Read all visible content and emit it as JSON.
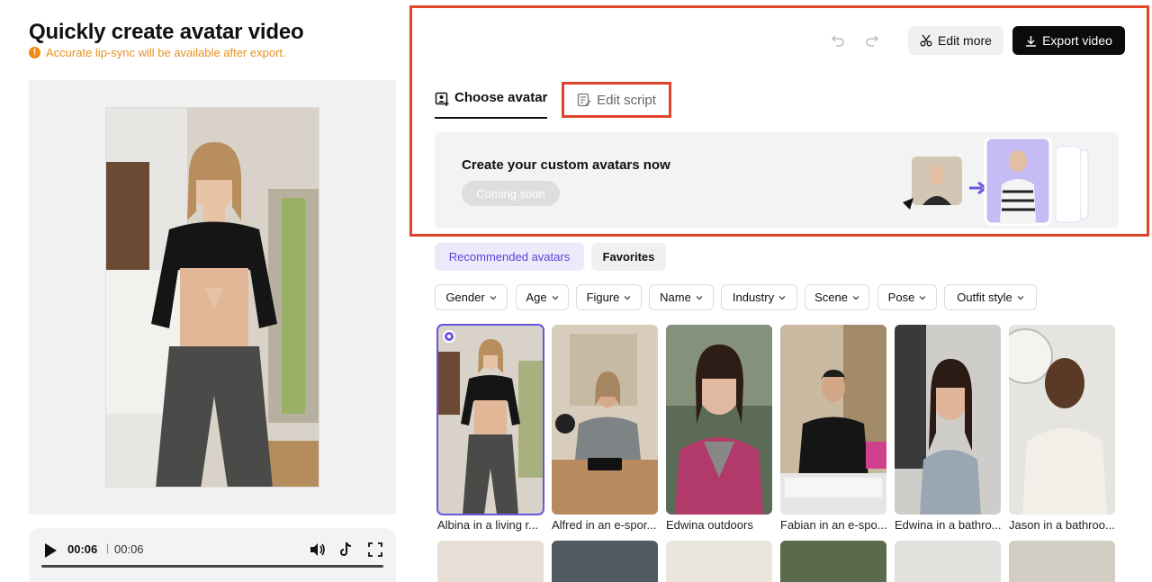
{
  "page": {
    "title": "Quickly create avatar video",
    "notice": "Accurate lip-sync will be available after export."
  },
  "player": {
    "current_time": "00:06",
    "separator": "|",
    "total_time": "00:06",
    "progress": 1.0
  },
  "toolbar": {
    "edit_more_label": "Edit more",
    "export_label": "Export video"
  },
  "tabs": [
    {
      "label": "Choose avatar",
      "active": true
    },
    {
      "label": "Edit script",
      "active": false
    }
  ],
  "banner": {
    "title": "Create your custom avatars now",
    "button_label": "Coming soon"
  },
  "avatar_tabs": [
    {
      "label": "Recommended avatars",
      "active": true
    },
    {
      "label": "Favorites",
      "active": false
    }
  ],
  "filters": [
    "Gender",
    "Age",
    "Figure",
    "Name",
    "Industry",
    "Scene",
    "Pose",
    "Outfit style"
  ],
  "avatars": [
    {
      "label": "Albina in a living r...",
      "selected": true
    },
    {
      "label": "Alfred in an e-spor...",
      "selected": false
    },
    {
      "label": "Edwina outdoors",
      "selected": false
    },
    {
      "label": "Fabian in an e-spo...",
      "selected": false
    },
    {
      "label": "Edwina in a bathro...",
      "selected": false
    },
    {
      "label": "Jason in a bathroo...",
      "selected": false
    }
  ],
  "colors": {
    "accent": "#6a55e0",
    "highlight": "#e0452a",
    "warning": "#e89020"
  }
}
